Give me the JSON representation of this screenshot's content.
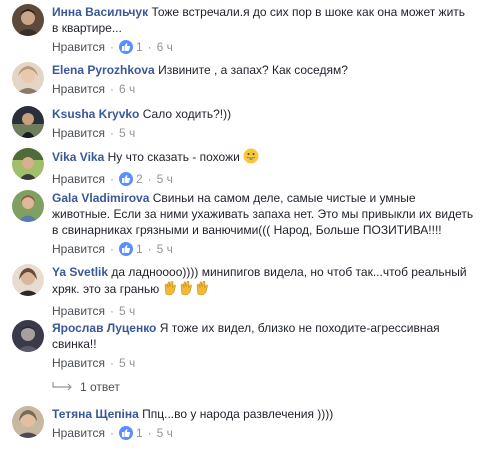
{
  "comments": [
    {
      "author": "Инна Васильчук",
      "text_line1": "Тоже встречали.я до сих пор в шоке как она может жить",
      "text_line2": "в квартире...",
      "like_label": "Нравится",
      "likes": "1",
      "time": "6 ч",
      "avatar_colors": [
        "#5e4a3a",
        "#c9a58a"
      ]
    },
    {
      "author": "Elena Pyrozhkova",
      "text_line1": "Извините , а запах? Как соседям?",
      "like_label": "Нравится",
      "time": "6 ч",
      "avatar_colors": [
        "#b89a78",
        "#e8d4c0"
      ]
    },
    {
      "author": "Ksusha Kryvko",
      "text_line1": "Сало ходить?!))",
      "like_label": "Нравится",
      "time": "5 ч",
      "avatar_colors": [
        "#2a2f3a",
        "#6f7d5c"
      ]
    },
    {
      "author": "Vika Vika",
      "text_line1": "Ну что сказать - похожи",
      "like_label": "Нравится",
      "likes": "2",
      "time": "5 ч",
      "avatar_colors": [
        "#4f6b3a",
        "#9fbf6a"
      ]
    },
    {
      "author": "Gala Vladimirova",
      "text_line1": "Свиньи на самом деле, самые чистые и умные",
      "text_line2": "животные. Если за ними ухаживать запаха нет. Это мы привыкли их видеть",
      "text_line3": "в свинарниках грязными и ванючими((( Народ, Больше ПОЗИТИВА!!!!",
      "like_label": "Нравится",
      "likes": "1",
      "time": "5 ч",
      "avatar_colors": [
        "#8a5a4a",
        "#7fa060"
      ]
    },
    {
      "author": "Ya Svetlik",
      "text_line1": "да ладноооо)))) минипигов видела, но чтоб так...чтоб реальный",
      "text_line2": "хряк. это за гранью",
      "like_label": "Нравится",
      "time": "5 ч",
      "avatar_colors": [
        "#6a4a3a",
        "#d8b898"
      ]
    },
    {
      "author": "Ярослав Луценко",
      "text_line1": "Я тоже их видел, близко не походите-агрессивная",
      "text_line2": "свинка!!",
      "like_label": "Нравится",
      "time": "5 ч",
      "avatar_colors": [
        "#3a3a48",
        "#a8a0a0"
      ]
    },
    {
      "author": "Тетяна Щепіна",
      "text_line1": "Ппц...во у народа развлечения ))))",
      "like_label": "Нравится",
      "likes": "1",
      "time": "5 ч",
      "avatar_colors": [
        "#7a6a5a",
        "#c8b8a0"
      ]
    }
  ],
  "reply": {
    "label": "1 ответ"
  },
  "colors": {
    "author": "#385898",
    "like_badge": "#5890ff",
    "meta": "#90949c",
    "text": "#1d2129"
  }
}
